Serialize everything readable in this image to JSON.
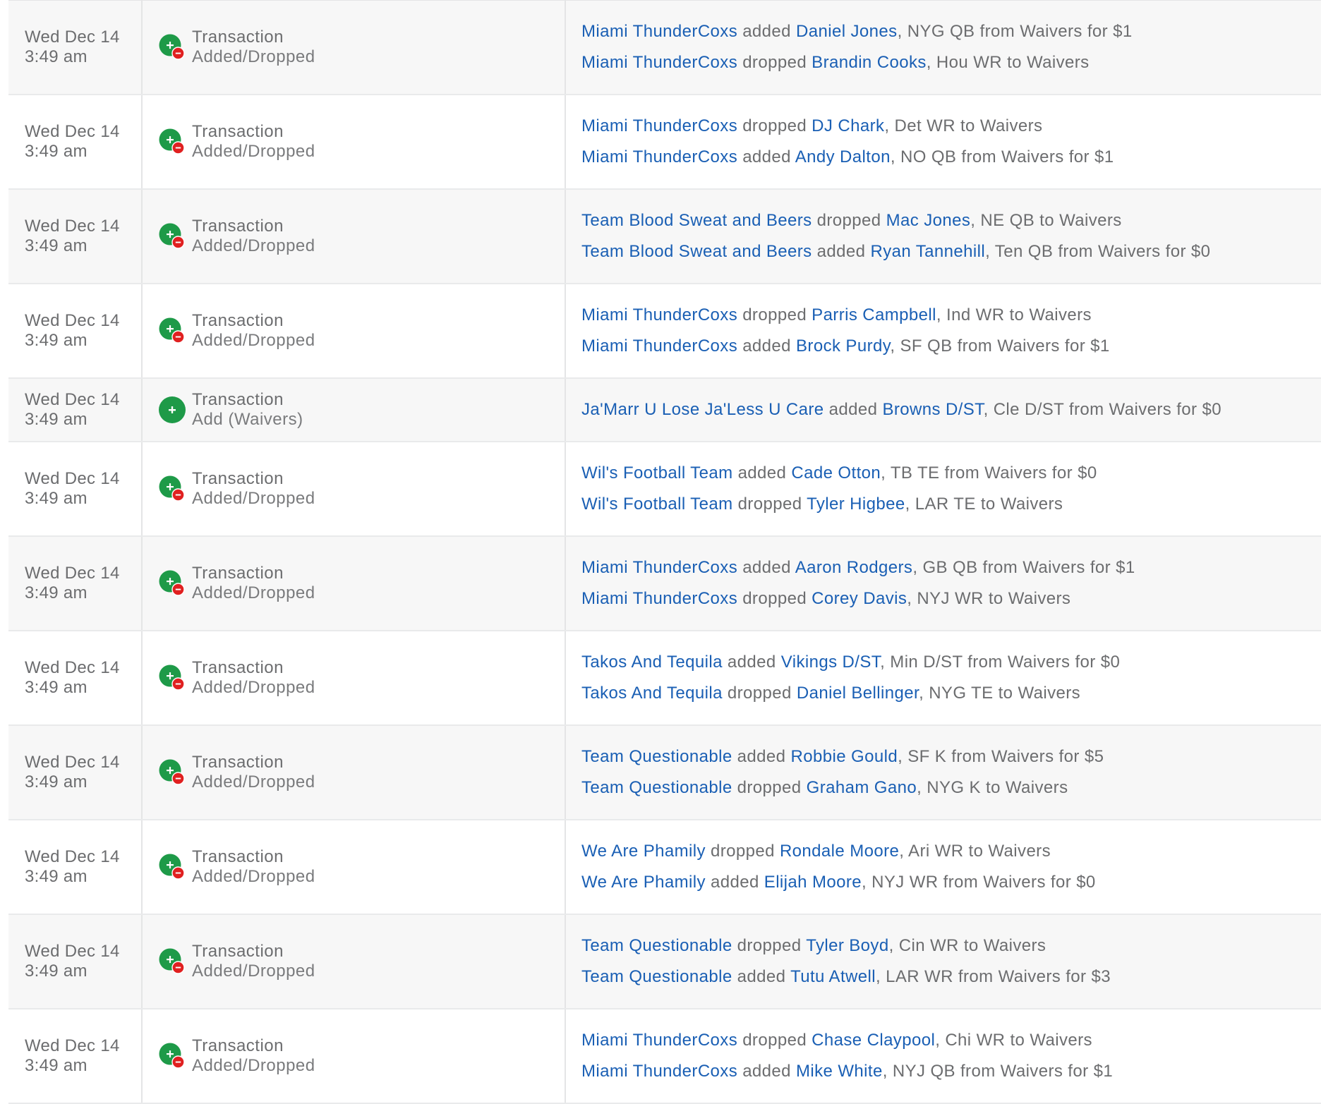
{
  "colors": {
    "link": "#1a5fb4",
    "text": "#6c6d6f",
    "add_icon": "#1e9a48",
    "drop_icon": "#e02020",
    "row_alt": "#f7f7f7"
  },
  "icons": {
    "added_dropped": "plus-minus-icon",
    "add": "plus-icon"
  },
  "rows": [
    {
      "date": "Wed Dec 14",
      "time": "3:49 am",
      "type": "Transaction",
      "subtype": "Added/Dropped",
      "icon": "added_dropped",
      "lines": [
        {
          "team": "Miami ThunderCoxs",
          "action": "added",
          "player": "Daniel Jones",
          "rest": ", NYG QB from Waivers for $1"
        },
        {
          "team": "Miami ThunderCoxs",
          "action": "dropped",
          "player": "Brandin Cooks",
          "rest": ", Hou WR to Waivers"
        }
      ]
    },
    {
      "date": "Wed Dec 14",
      "time": "3:49 am",
      "type": "Transaction",
      "subtype": "Added/Dropped",
      "icon": "added_dropped",
      "lines": [
        {
          "team": "Miami ThunderCoxs",
          "action": "dropped",
          "player": "DJ Chark",
          "rest": ", Det WR to Waivers"
        },
        {
          "team": "Miami ThunderCoxs",
          "action": "added",
          "player": "Andy Dalton",
          "rest": ", NO QB from Waivers for $1"
        }
      ]
    },
    {
      "date": "Wed Dec 14",
      "time": "3:49 am",
      "type": "Transaction",
      "subtype": "Added/Dropped",
      "icon": "added_dropped",
      "lines": [
        {
          "team": "Team Blood Sweat and Beers",
          "action": "dropped",
          "player": "Mac Jones",
          "rest": ", NE QB to Waivers"
        },
        {
          "team": "Team Blood Sweat and Beers",
          "action": "added",
          "player": "Ryan Tannehill",
          "rest": ", Ten QB from Waivers for $0"
        }
      ]
    },
    {
      "date": "Wed Dec 14",
      "time": "3:49 am",
      "type": "Transaction",
      "subtype": "Added/Dropped",
      "icon": "added_dropped",
      "lines": [
        {
          "team": "Miami ThunderCoxs",
          "action": "dropped",
          "player": "Parris Campbell",
          "rest": ", Ind WR to Waivers"
        },
        {
          "team": "Miami ThunderCoxs",
          "action": "added",
          "player": "Brock Purdy",
          "rest": ", SF QB from Waivers for $1"
        }
      ]
    },
    {
      "date": "Wed Dec 14",
      "time": "3:49 am",
      "type": "Transaction",
      "subtype": "Add (Waivers)",
      "icon": "add",
      "lines": [
        {
          "team": "Ja'Marr U Lose Ja'Less U Care",
          "action": "added",
          "player": "Browns D/ST",
          "rest": ", Cle D/ST from Waivers for $0"
        }
      ]
    },
    {
      "date": "Wed Dec 14",
      "time": "3:49 am",
      "type": "Transaction",
      "subtype": "Added/Dropped",
      "icon": "added_dropped",
      "lines": [
        {
          "team": "Wil's Football Team",
          "action": "added",
          "player": "Cade Otton",
          "rest": ", TB TE from Waivers for $0"
        },
        {
          "team": "Wil's Football Team",
          "action": "dropped",
          "player": "Tyler Higbee",
          "rest": ", LAR TE to Waivers"
        }
      ]
    },
    {
      "date": "Wed Dec 14",
      "time": "3:49 am",
      "type": "Transaction",
      "subtype": "Added/Dropped",
      "icon": "added_dropped",
      "lines": [
        {
          "team": "Miami ThunderCoxs",
          "action": "added",
          "player": "Aaron Rodgers",
          "rest": ", GB QB from Waivers for $1"
        },
        {
          "team": "Miami ThunderCoxs",
          "action": "dropped",
          "player": "Corey Davis",
          "rest": ", NYJ WR to Waivers"
        }
      ]
    },
    {
      "date": "Wed Dec 14",
      "time": "3:49 am",
      "type": "Transaction",
      "subtype": "Added/Dropped",
      "icon": "added_dropped",
      "lines": [
        {
          "team": "Takos And Tequila",
          "action": "added",
          "player": "Vikings D/ST",
          "rest": ", Min D/ST from Waivers for $0"
        },
        {
          "team": "Takos And Tequila",
          "action": "dropped",
          "player": "Daniel Bellinger",
          "rest": ", NYG TE to Waivers"
        }
      ]
    },
    {
      "date": "Wed Dec 14",
      "time": "3:49 am",
      "type": "Transaction",
      "subtype": "Added/Dropped",
      "icon": "added_dropped",
      "lines": [
        {
          "team": "Team Questionable",
          "action": "added",
          "player": "Robbie Gould",
          "rest": ", SF K from Waivers for $5"
        },
        {
          "team": "Team Questionable",
          "action": "dropped",
          "player": "Graham Gano",
          "rest": ", NYG K to Waivers"
        }
      ]
    },
    {
      "date": "Wed Dec 14",
      "time": "3:49 am",
      "type": "Transaction",
      "subtype": "Added/Dropped",
      "icon": "added_dropped",
      "lines": [
        {
          "team": "We Are Phamily",
          "action": "dropped",
          "player": "Rondale Moore",
          "rest": ", Ari WR to Waivers"
        },
        {
          "team": "We Are Phamily",
          "action": "added",
          "player": "Elijah Moore",
          "rest": ", NYJ WR from Waivers for $0"
        }
      ]
    },
    {
      "date": "Wed Dec 14",
      "time": "3:49 am",
      "type": "Transaction",
      "subtype": "Added/Dropped",
      "icon": "added_dropped",
      "lines": [
        {
          "team": "Team Questionable",
          "action": "dropped",
          "player": "Tyler Boyd",
          "rest": ", Cin WR to Waivers"
        },
        {
          "team": "Team Questionable",
          "action": "added",
          "player": "Tutu Atwell",
          "rest": ", LAR WR from Waivers for $3"
        }
      ]
    },
    {
      "date": "Wed Dec 14",
      "time": "3:49 am",
      "type": "Transaction",
      "subtype": "Added/Dropped",
      "icon": "added_dropped",
      "lines": [
        {
          "team": "Miami ThunderCoxs",
          "action": "dropped",
          "player": "Chase Claypool",
          "rest": ", Chi WR to Waivers"
        },
        {
          "team": "Miami ThunderCoxs",
          "action": "added",
          "player": "Mike White",
          "rest": ", NYJ QB from Waivers for $1"
        }
      ]
    }
  ]
}
